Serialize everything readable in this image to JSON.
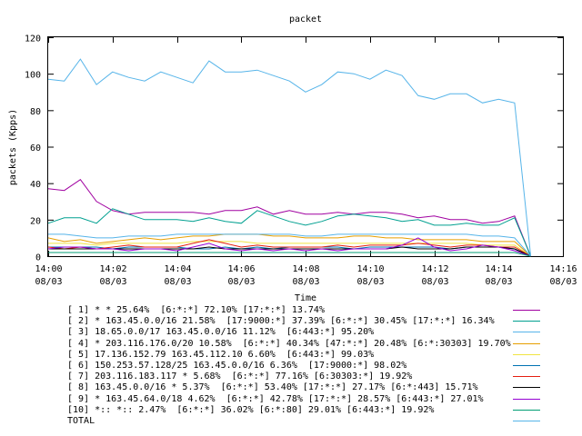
{
  "chart_data": {
    "type": "line",
    "title": "packet",
    "xlabel": "Time",
    "ylabel": "packets (Kpps)",
    "ylim": [
      0,
      120
    ],
    "yticks": [
      "0",
      "20",
      "40",
      "60",
      "80",
      "100",
      "120"
    ],
    "xticks": [
      {
        "time": "14:00",
        "date": "08/03"
      },
      {
        "time": "14:02",
        "date": "08/03"
      },
      {
        "time": "14:04",
        "date": "08/03"
      },
      {
        "time": "14:06",
        "date": "08/03"
      },
      {
        "time": "14:08",
        "date": "08/03"
      },
      {
        "time": "14:10",
        "date": "08/03"
      },
      {
        "time": "14:12",
        "date": "08/03"
      },
      {
        "time": "14:14",
        "date": "08/03"
      },
      {
        "time": "14:16",
        "date": "08/03"
      }
    ],
    "xlim": [
      "14:00",
      "14:16"
    ],
    "x": [
      "14:00",
      "14:00:30",
      "14:01",
      "14:01:30",
      "14:02",
      "14:02:30",
      "14:03",
      "14:03:30",
      "14:04",
      "14:04:30",
      "14:05",
      "14:05:30",
      "14:06",
      "14:06:30",
      "14:07",
      "14:07:30",
      "14:08",
      "14:08:30",
      "14:09",
      "14:09:30",
      "14:10",
      "14:10:30",
      "14:11",
      "14:11:30",
      "14:12",
      "14:12:30",
      "14:13",
      "14:13:30",
      "14:14",
      "14:14:30",
      "14:15"
    ],
    "series": [
      {
        "name": "[ 1] * * 25.64%  [6:*:*] 72.10% [17:*:*] 13.74%",
        "color": "#a000a0",
        "values": [
          37,
          36,
          42,
          30,
          25,
          23,
          24,
          24,
          24,
          24,
          23,
          25,
          25,
          27,
          23,
          25,
          23,
          23,
          24,
          23,
          24,
          24,
          23,
          21,
          22,
          20,
          20,
          18,
          19,
          22,
          0
        ]
      },
      {
        "name": "[ 2] * 163.45.0.0/16 21.58%  [17:9000:*] 37.39% [6:*:*] 30.45% [17:*:*] 16.34%",
        "color": "#00a090",
        "values": [
          18,
          21,
          21,
          18,
          26,
          23,
          20,
          20,
          20,
          19,
          21,
          19,
          18,
          25,
          22,
          19,
          17,
          19,
          22,
          23,
          22,
          21,
          19,
          20,
          17,
          17,
          18,
          17,
          17,
          21,
          0
        ]
      },
      {
        "name": "[ 3] 18.65.0.0/17 163.45.0.0/16 11.12%  [6:443:*] 95.20%",
        "color": "#56b4e9",
        "values": [
          97,
          96,
          108,
          94,
          101,
          98,
          96,
          101,
          98,
          95,
          107,
          101,
          101,
          102,
          99,
          96,
          90,
          94,
          101,
          100,
          97,
          102,
          99,
          88,
          86,
          89,
          89,
          84,
          86,
          84,
          0
        ]
      },
      {
        "name": "[ 4] * 203.116.176.0/20 10.58%  [6:*:*] 40.34% [47:*:*] 20.48% [6:*:30303] 19.70%",
        "color": "#e69f00",
        "values": [
          10,
          8,
          9,
          7,
          8,
          9,
          10,
          9,
          10,
          11,
          11,
          12,
          12,
          12,
          11,
          11,
          10,
          10,
          10,
          11,
          11,
          10,
          10,
          9,
          9,
          9,
          9,
          8,
          8,
          8,
          0
        ]
      },
      {
        "name": "[ 5] 17.136.152.79 163.45.112.10 6.60%  [6:443:*] 99.03%",
        "color": "#f0e442",
        "values": [
          7,
          7,
          7,
          6,
          7,
          7,
          7,
          7,
          7,
          8,
          8,
          8,
          8,
          7,
          7,
          7,
          7,
          7,
          7,
          7,
          7,
          7,
          7,
          7,
          7,
          7,
          7,
          6,
          6,
          6,
          0
        ]
      },
      {
        "name": "[ 6] 150.253.57.128/25 163.45.0.0/16 6.36%  [17:9000:*] 98.02%",
        "color": "#0072b2",
        "values": [
          5,
          5,
          5,
          5,
          4,
          5,
          5,
          5,
          5,
          4,
          4,
          5,
          4,
          5,
          4,
          5,
          5,
          5,
          5,
          4,
          5,
          5,
          5,
          5,
          5,
          4,
          5,
          5,
          5,
          4,
          0
        ]
      },
      {
        "name": "[ 7] 203.116.183.117 * 5.68%  [6:*:*] 77.16% [6:30303:*] 19.92%",
        "color": "#e51e10",
        "values": [
          5,
          4,
          5,
          4,
          5,
          6,
          5,
          5,
          5,
          7,
          9,
          7,
          5,
          6,
          5,
          5,
          5,
          5,
          6,
          5,
          6,
          6,
          6,
          7,
          6,
          5,
          6,
          6,
          5,
          5,
          0
        ]
      },
      {
        "name": "[ 8] 163.45.0.0/16 * 5.37%  [6:*:*] 53.40% [17:*:*] 27.17% [6:*:443] 15.71%",
        "color": "#000000",
        "values": [
          4,
          4,
          4,
          4,
          4,
          4,
          4,
          4,
          4,
          4,
          5,
          4,
          4,
          4,
          4,
          4,
          4,
          4,
          4,
          4,
          4,
          4,
          5,
          4,
          4,
          4,
          5,
          5,
          5,
          4,
          0
        ]
      },
      {
        "name": "[ 9] * 163.45.64.0/18 4.62%  [6:*:*] 42.78% [17:*:*] 28.57% [6:443:*] 27.01%",
        "color": "#9400d3",
        "values": [
          4,
          5,
          5,
          4,
          4,
          3,
          4,
          4,
          3,
          5,
          7,
          4,
          3,
          4,
          3,
          4,
          3,
          4,
          3,
          4,
          4,
          4,
          6,
          10,
          5,
          3,
          4,
          6,
          5,
          3,
          0
        ]
      },
      {
        "name": "[10] *:: *:: 2.47%  [6:*:*] 36.02% [6:*:80] 29.01% [6:443:*] 19.92%",
        "color": "#009e73",
        "values": [
          2,
          2,
          2,
          2,
          2,
          2,
          2,
          2,
          2,
          2,
          2,
          2,
          2,
          2,
          2,
          2,
          2,
          2,
          2,
          2,
          2,
          2,
          2,
          2,
          2,
          2,
          2,
          2,
          2,
          2,
          0
        ]
      },
      {
        "name": "TOTAL",
        "color": "#56b4e9",
        "values": [
          12,
          12,
          11,
          10,
          10,
          11,
          11,
          11,
          12,
          12,
          12,
          12,
          12,
          12,
          12,
          12,
          11,
          11,
          12,
          12,
          12,
          12,
          12,
          12,
          12,
          12,
          12,
          11,
          11,
          10,
          0
        ]
      }
    ],
    "grid": false,
    "legend_position": "bottom"
  }
}
